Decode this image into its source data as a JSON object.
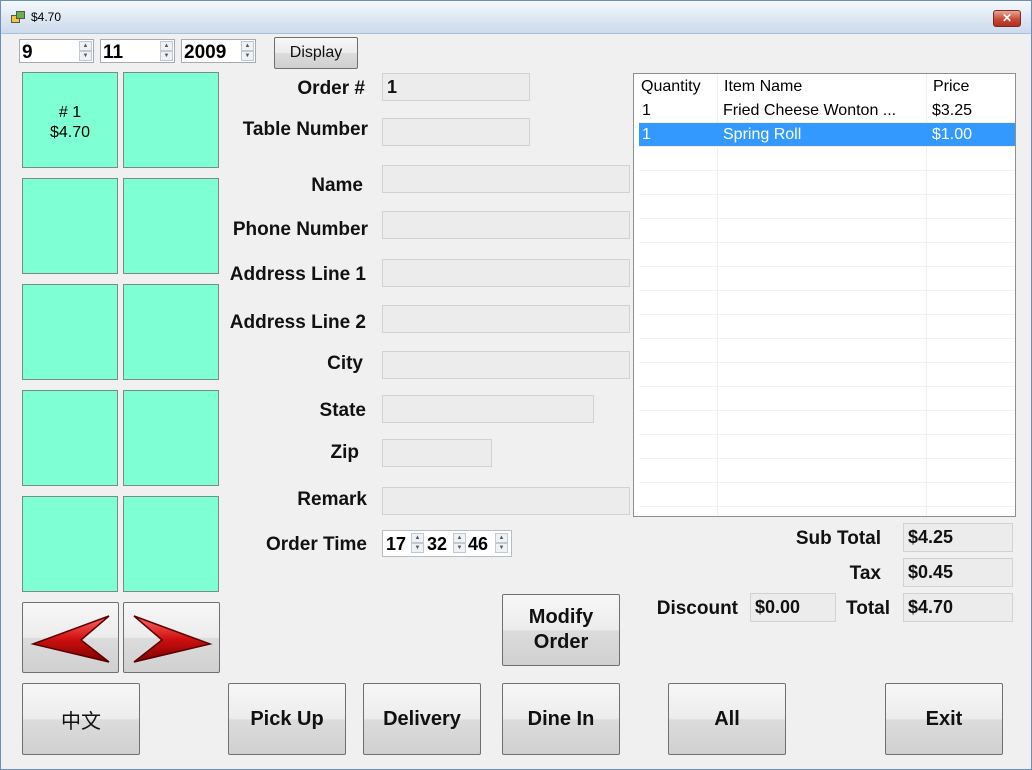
{
  "window": {
    "title": "$4.70"
  },
  "date": {
    "month": "9",
    "day": "11",
    "year": "2009",
    "display_label": "Display"
  },
  "tiles": [
    {
      "order": "# 1",
      "amount": "$4.70"
    },
    {
      "order": "",
      "amount": ""
    },
    {
      "order": "",
      "amount": ""
    },
    {
      "order": "",
      "amount": ""
    },
    {
      "order": "",
      "amount": ""
    },
    {
      "order": "",
      "amount": ""
    },
    {
      "order": "",
      "amount": ""
    },
    {
      "order": "",
      "amount": ""
    },
    {
      "order": "",
      "amount": ""
    },
    {
      "order": "",
      "amount": ""
    }
  ],
  "form": {
    "order_no_label": "Order #",
    "order_no": "1",
    "table_number_label": "Table Number",
    "table_number": "",
    "name_label": "Name",
    "name": "",
    "phone_label": "Phone Number",
    "phone": "",
    "address1_label": "Address Line 1",
    "address1": "",
    "address2_label": "Address Line 2",
    "address2": "",
    "city_label": "City",
    "city": "",
    "state_label": "State",
    "state": "",
    "zip_label": "Zip",
    "zip": "",
    "remark_label": "Remark",
    "remark": "",
    "order_time_label": "Order Time",
    "order_time": {
      "hour": "17",
      "minute": "32",
      "second": "46"
    }
  },
  "items_grid": {
    "columns": [
      "Quantity",
      "Item Name",
      "Price"
    ],
    "rows": [
      {
        "quantity": "1",
        "name": "Fried Cheese Wonton ...",
        "price": "$3.25",
        "selected": false
      },
      {
        "quantity": "1",
        "name": "Spring Roll",
        "price": "$1.00",
        "selected": true
      }
    ]
  },
  "totals": {
    "subtotal_label": "Sub Total",
    "subtotal": "$4.25",
    "tax_label": "Tax",
    "tax": "$0.45",
    "discount_label": "Discount",
    "discount": "$0.00",
    "total_label": "Total",
    "total": "$4.70"
  },
  "buttons": {
    "modify_order": "Modify Order",
    "chinese": "中文",
    "pick_up": "Pick Up",
    "delivery": "Delivery",
    "dine_in": "Dine In",
    "all": "All",
    "exit": "Exit"
  },
  "colors": {
    "tile": "#7fffd4",
    "selection": "#3399ff",
    "arrow": "#d01010"
  }
}
